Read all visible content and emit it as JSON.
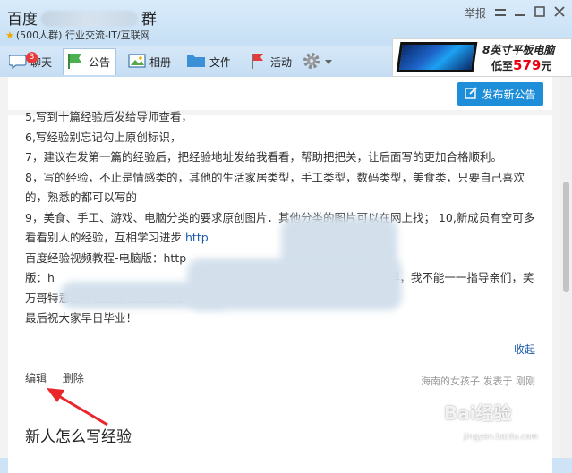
{
  "window": {
    "group_name_prefix": "百度",
    "group_name_suffix": "群",
    "group_meta": "(500人群) 行业交流-IT/互联网",
    "report_label": "举报"
  },
  "ad": {
    "line1": "8英寸平板电脑",
    "price_prefix": "低至",
    "price": "579",
    "price_unit": "元"
  },
  "toolbar": {
    "tabs": [
      {
        "label": "聊天",
        "badge": "3"
      },
      {
        "label": "公告"
      },
      {
        "label": "相册"
      },
      {
        "label": "文件"
      },
      {
        "label": "活动"
      }
    ]
  },
  "publish_label": "发布新公告",
  "article": {
    "lines": [
      "5,写到十篇经验后发给导师查看，",
      "6,写经验别忘记勾上原创标识，",
      "7，建议在发第一篇的经验后，把经验地址发给我看看，帮助把把关，让后面写的更加合格顺利。",
      "8，写的经验，不止是情感类的，其他的生活家居类型，手工类型，数码类型，美食类，只要自己喜欢的，熟悉的都可以写的",
      "9，美食、手工、游戏、电脑分类的要求原创图片．其他分类的图片可以在网上找；  10,新成员有空可多看看别人的经验，互相学习进步",
      "百度经验视频教程-电脑版：http",
      "版：h",
      "X1  由于有些小伙伴来的时间不一样，我不能一一指导亲们，笑万哥特意制作视频教程配合文档一起看会提高学习速度..",
      "最后祝大家早日毕业！"
    ],
    "link_tail": "http",
    "link_tail2": "m/"
  },
  "collapse_label": "收起",
  "actions": {
    "edit": "编辑",
    "delete": "删除"
  },
  "author": "海南的女孩子 发表于 刚刚",
  "next_title": "新人怎么写经验",
  "watermark": {
    "main": "Bai经验",
    "sub": "jingyan.baidu.com"
  }
}
